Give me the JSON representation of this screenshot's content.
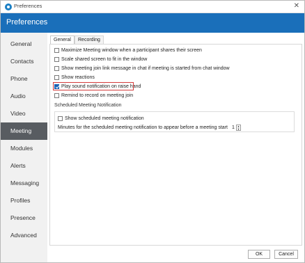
{
  "window": {
    "title": "Preferences",
    "close_glyph": "✕"
  },
  "header": {
    "title": "Preferences"
  },
  "sidebar": {
    "items": [
      {
        "label": "General"
      },
      {
        "label": "Contacts"
      },
      {
        "label": "Phone"
      },
      {
        "label": "Audio"
      },
      {
        "label": "Video"
      },
      {
        "label": "Meeting",
        "selected": true
      },
      {
        "label": "Modules"
      },
      {
        "label": "Alerts"
      },
      {
        "label": "Messaging"
      },
      {
        "label": "Profiles"
      },
      {
        "label": "Presence"
      },
      {
        "label": "Advanced"
      }
    ]
  },
  "tabs": [
    {
      "label": "General",
      "active": true
    },
    {
      "label": "Recording",
      "active": false
    }
  ],
  "options": [
    {
      "label": "Maximize Meeting window when a participant shares their screen",
      "checked": false
    },
    {
      "label": "Scale shared screen to fit in the window",
      "checked": false
    },
    {
      "label": "Show meeting join link message in chat if meeting is started from chat window",
      "checked": false
    },
    {
      "label": "Show reactions",
      "checked": false
    },
    {
      "label": "Play sound notification on raise hand",
      "checked": true
    },
    {
      "label": "Remind to record on meeting join",
      "checked": false
    }
  ],
  "scheduled": {
    "section_title": "Scheduled Meeting Notification",
    "show_label": "Show scheduled meeting notification",
    "show_checked": false,
    "minutes_label": "Minutes for the scheduled meeting notification to appear before a meeting start",
    "minutes_value": "1"
  },
  "buttons": {
    "ok": "OK",
    "cancel": "Cancel"
  },
  "colors": {
    "header": "#1a6fba",
    "selected_nav": "#585c61",
    "checkbox_checked": "#1a62b5",
    "highlight": "#d33b3b"
  },
  "icons": {
    "app": "app-logo-icon",
    "close": "close-icon",
    "spin_up": "chevron-up-icon",
    "spin_down": "chevron-down-icon"
  }
}
